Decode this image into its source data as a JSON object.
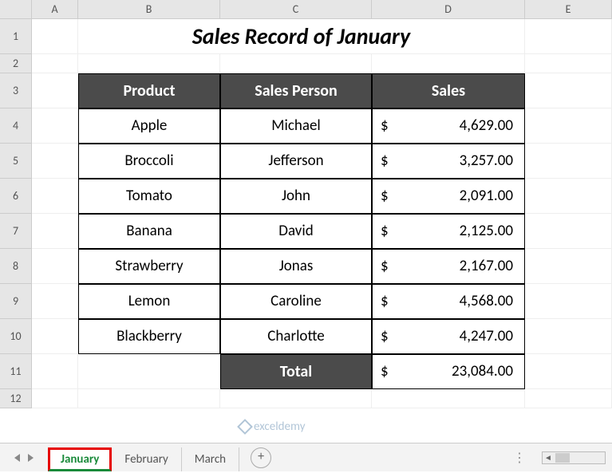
{
  "columns": [
    "A",
    "B",
    "C",
    "D",
    "E"
  ],
  "rows": [
    "1",
    "2",
    "3",
    "4",
    "5",
    "6",
    "7",
    "8",
    "9",
    "10",
    "11",
    "12"
  ],
  "title": "Sales Record of January",
  "headers": {
    "product": "Product",
    "person": "Sales Person",
    "sales": "Sales"
  },
  "data": [
    {
      "product": "Apple",
      "person": "Michael",
      "currency": "$",
      "amount": "4,629.00"
    },
    {
      "product": "Broccoli",
      "person": "Jefferson",
      "currency": "$",
      "amount": "3,257.00"
    },
    {
      "product": "Tomato",
      "person": "John",
      "currency": "$",
      "amount": "2,091.00"
    },
    {
      "product": "Banana",
      "person": "David",
      "currency": "$",
      "amount": "2,125.00"
    },
    {
      "product": "Strawberry",
      "person": "Jonas",
      "currency": "$",
      "amount": "2,167.00"
    },
    {
      "product": "Lemon",
      "person": "Caroline",
      "currency": "$",
      "amount": "4,568.00"
    },
    {
      "product": "Blackberry",
      "person": "Charlotte",
      "currency": "$",
      "amount": "4,247.00"
    }
  ],
  "total": {
    "label": "Total",
    "currency": "$",
    "amount": "23,084.00"
  },
  "tabs": {
    "active": "January",
    "others": [
      "February",
      "March"
    ]
  },
  "watermark": "exceldemy"
}
